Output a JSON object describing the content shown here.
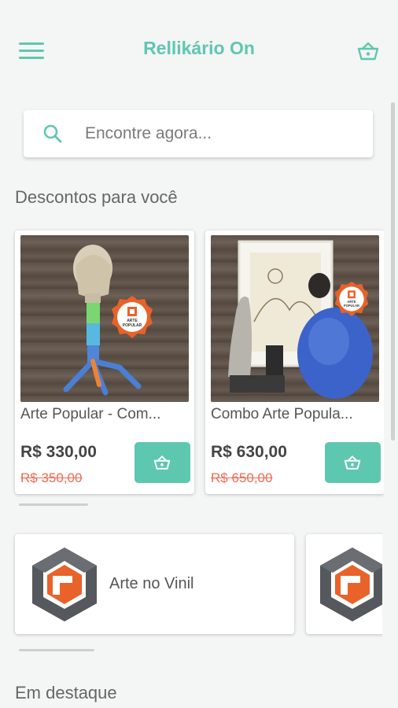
{
  "header": {
    "title": "Rellikário On",
    "menu_icon": "hamburger-menu-icon",
    "cart_icon": "basket-icon"
  },
  "search": {
    "placeholder": "Encontre agora...",
    "value": "",
    "icon": "search-icon"
  },
  "discounts": {
    "title": "Descontos para você",
    "items": [
      {
        "name": "Arte Popular - Com...",
        "price": "R$ 330,00",
        "old_price": "R$ 350,00",
        "badge_text": "ARTE POPULAR"
      },
      {
        "name": "Combo Arte Popula...",
        "price": "R$ 630,00",
        "old_price": "R$ 650,00",
        "badge_text": "ARTE POPULAR"
      }
    ]
  },
  "categories": {
    "items": [
      {
        "label": "Arte no Vinil"
      },
      {
        "label": ""
      }
    ]
  },
  "featured": {
    "title": "Em destaque"
  },
  "colors": {
    "accent": "#5ec7b0",
    "old_price": "#ee6c55",
    "badge_orange": "#e8622a",
    "logo_gray": "#55585c"
  }
}
